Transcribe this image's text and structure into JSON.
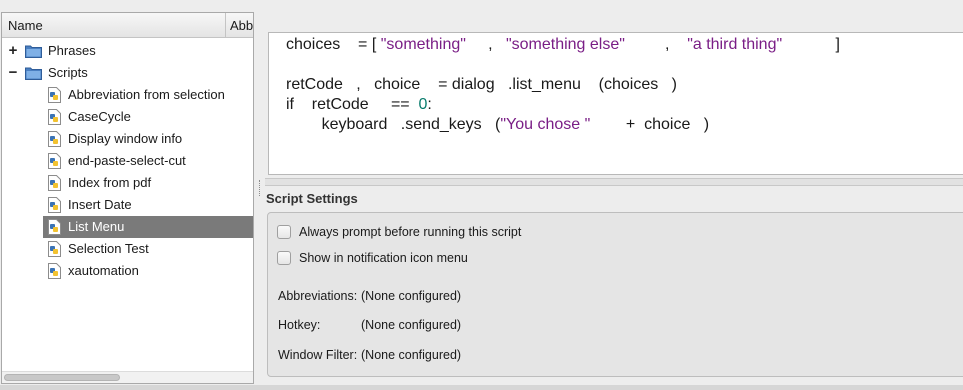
{
  "tree": {
    "columns": {
      "name": "Name",
      "abbr": "Abb"
    },
    "items": [
      {
        "label": "Phrases",
        "kind": "folder",
        "expander": "+"
      },
      {
        "label": "Scripts",
        "kind": "folder",
        "expander": "−"
      },
      {
        "label": "Abbreviation from selection",
        "kind": "script"
      },
      {
        "label": "CaseCycle",
        "kind": "script"
      },
      {
        "label": "Display window info",
        "kind": "script"
      },
      {
        "label": "end-paste-select-cut",
        "kind": "script"
      },
      {
        "label": "Index from pdf",
        "kind": "script"
      },
      {
        "label": "Insert Date",
        "kind": "script"
      },
      {
        "label": "List Menu",
        "kind": "script",
        "selected": true
      },
      {
        "label": "Selection Test",
        "kind": "script"
      },
      {
        "label": "xautomation",
        "kind": "script"
      }
    ]
  },
  "editor": {
    "line1": {
      "ident": "choices",
      "op": "=",
      "open": "[",
      "s1": "\"something\"",
      "comma1": ",",
      "s2": "\"something else\"",
      "comma2": ",",
      "s3": "\"a third thing\"",
      "close": "]"
    },
    "line2": {
      "a": "retCode",
      "comma": ",",
      "b": "choice",
      "op": "=",
      "obj": "dialog",
      "dot": ".",
      "fn": "list_menu",
      "open": "(",
      "arg": "choices",
      "close": ")"
    },
    "line3": {
      "kw": "if",
      "a": "retCode",
      "op": "==",
      "num": "0",
      "colon": ":"
    },
    "line4": {
      "obj": "keyboard",
      "dot": ".",
      "fn": "send_keys",
      "open": "(",
      "str": "\"You chose \"",
      "plus": "+",
      "arg": "choice",
      "close": ")"
    }
  },
  "settings": {
    "title": "Script Settings",
    "always_prompt": "Always prompt before running this script",
    "show_in_menu": "Show in notification icon menu",
    "abbreviations_label": "Abbreviations:",
    "abbreviations_value": "(None configured)",
    "hotkey_label": "Hotkey:",
    "hotkey_value": "(None configured)",
    "window_filter_label": "Window Filter:",
    "window_filter_value": "(None configured)"
  },
  "colors": {
    "selection": "#7a7a7a",
    "string": "#7a1e86",
    "number": "#0a7c6d",
    "folder": "#4a7fc1"
  }
}
